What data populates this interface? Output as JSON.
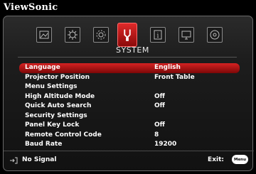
{
  "brand": "ViewSonic",
  "menu_title": "SYSTEM",
  "tabs": [
    {
      "icon": "picture-icon"
    },
    {
      "icon": "advanced-icon"
    },
    {
      "icon": "setup-icon"
    },
    {
      "icon": "system-icon",
      "active": true
    },
    {
      "icon": "information-icon"
    },
    {
      "icon": "display-icon"
    },
    {
      "icon": "audio-icon"
    }
  ],
  "rows": [
    {
      "label": "Language",
      "value": "English",
      "selected": true
    },
    {
      "label": "Projector Position",
      "value": "Front Table"
    },
    {
      "label": "Menu Settings",
      "value": ""
    },
    {
      "label": "High Altitude Mode",
      "value": "Off"
    },
    {
      "label": "Quick Auto Search",
      "value": "Off"
    },
    {
      "label": "Security Settings",
      "value": ""
    },
    {
      "label": "Panel Key Lock",
      "value": "Off"
    },
    {
      "label": "Remote Control Code",
      "value": "8"
    },
    {
      "label": "Baud Rate",
      "value": "19200"
    }
  ],
  "status": {
    "text": "No Signal",
    "icon": "input-source-icon"
  },
  "exit": {
    "label": "Exit:",
    "button_label": "Menu"
  },
  "colors": {
    "highlight": "#c41a1a",
    "active_tab": "#d42222"
  }
}
